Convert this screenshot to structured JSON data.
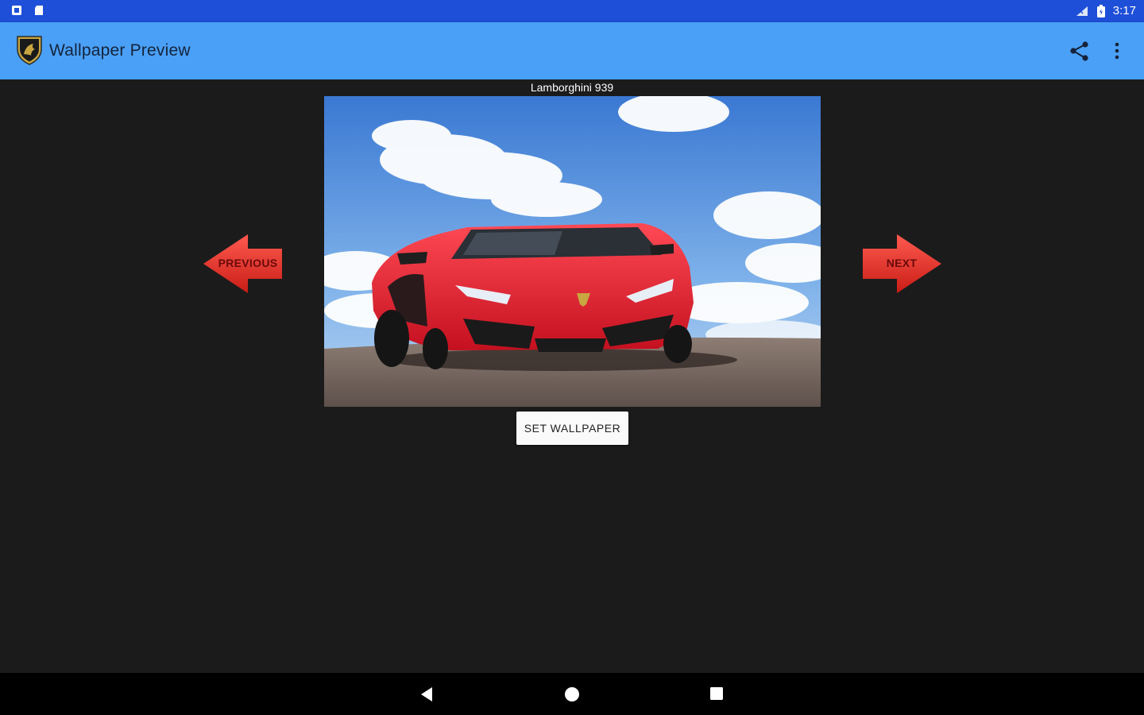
{
  "status_bar": {
    "time": "3:17",
    "icons": [
      "notification-icon",
      "sd-card-icon",
      "signal-icon",
      "battery-icon"
    ]
  },
  "app_bar": {
    "title": "Wallpaper Preview",
    "logo_icon": "lamborghini-shield-icon",
    "actions": [
      "share-icon",
      "more-vert-icon"
    ],
    "color": "#4aa0f7"
  },
  "wallpaper": {
    "name": "Lamborghini 939"
  },
  "navigation": {
    "previous_label": "PREVIOUS",
    "next_label": "NEXT",
    "arrow_color": "#e0312a"
  },
  "actions": {
    "set_wallpaper_label": "SET WALLPAPER"
  },
  "system_nav": {
    "icons": [
      "back-icon",
      "home-icon",
      "recents-icon"
    ]
  }
}
